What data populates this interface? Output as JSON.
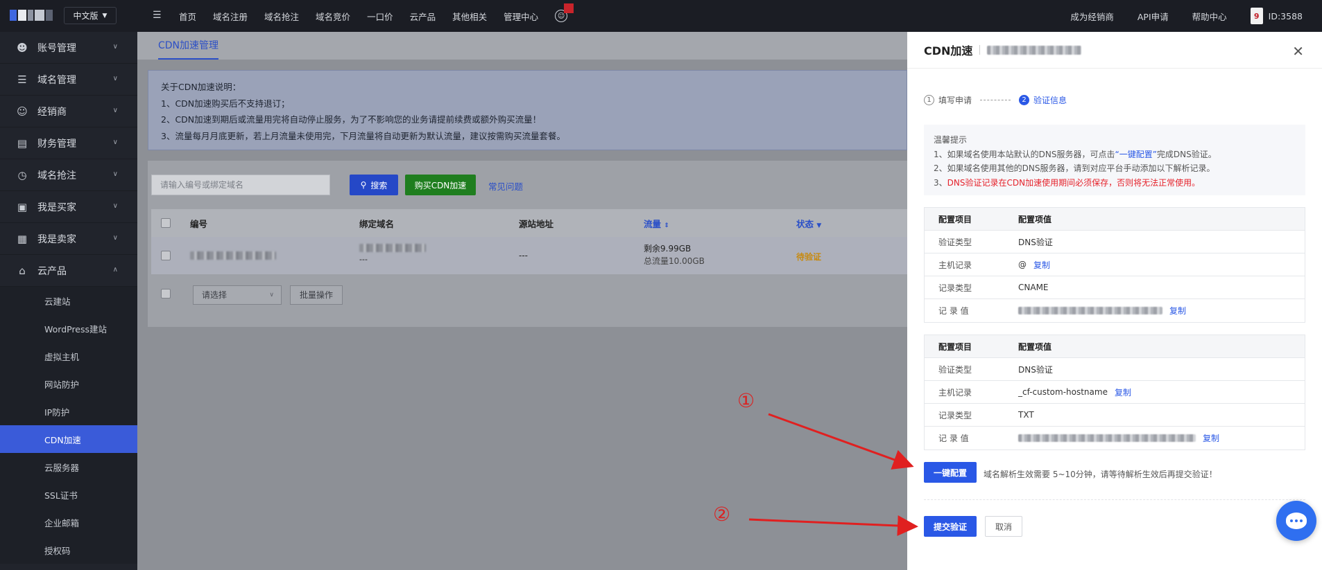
{
  "topbar": {
    "lang": "中文版",
    "nav": [
      "首页",
      "域名注册",
      "域名抢注",
      "域名竞价",
      "一口价",
      "云产品",
      "其他相关",
      "管理中心"
    ],
    "right": [
      "成为经销商",
      "API申请",
      "帮助中心"
    ],
    "avatar_text": "9",
    "user_id": "ID:3588"
  },
  "sidebar": {
    "items": [
      {
        "label": "账号管理",
        "icon": "user-icon"
      },
      {
        "label": "域名管理",
        "icon": "layers-icon"
      },
      {
        "label": "经销商",
        "icon": "agent-icon"
      },
      {
        "label": "财务管理",
        "icon": "finance-icon"
      },
      {
        "label": "域名抢注",
        "icon": "clock-icon"
      },
      {
        "label": "我是买家",
        "icon": "cart-icon"
      },
      {
        "label": "我是卖家",
        "icon": "shop-icon"
      },
      {
        "label": "云产品",
        "icon": "cloud-icon"
      }
    ],
    "sub": [
      "云建站",
      "WordPress建站",
      "虚拟主机",
      "网站防护",
      "IP防护",
      "CDN加速",
      "云服务器",
      "SSL证书",
      "企业邮箱",
      "授权码"
    ],
    "active_sub": "CDN加速"
  },
  "main": {
    "tab": "CDN加速管理",
    "notice": [
      "关于CDN加速说明：",
      "1、CDN加速购买后不支持退订；",
      "2、CDN加速到期后或流量用完将自动停止服务，为了不影响您的业务请提前续费或额外购买流量！",
      "3、流量每月月底更新，若上月流量未使用完，下月流量将自动更新为默认流量，建议按需购买流量套餐。"
    ],
    "search_placeholder": "请输入编号或绑定域名",
    "search_btn": "搜索",
    "buy_btn": "购买CDN加速",
    "faq": "常见问题",
    "columns": [
      "编号",
      "绑定域名",
      "源站地址",
      "流量",
      "状态"
    ],
    "row": {
      "domain_sub": "---",
      "origin": "---",
      "remain": "剩余9.99GB",
      "total": "总流量10.00GB",
      "status": "待验证"
    },
    "select_placeholder": "请选择",
    "batch_btn": "批量操作"
  },
  "drawer": {
    "title": "CDN加速",
    "steps": [
      {
        "num": "1",
        "label": "填写申请"
      },
      {
        "num": "2",
        "label": "验证信息"
      }
    ],
    "tips": {
      "title": "温馨提示",
      "line1_a": "1、如果域名使用本站默认的DNS服务器，可点击",
      "line1_link": "“一键配置”",
      "line1_b": "完成DNS验证。",
      "line2": "2、如果域名使用其他的DNS服务器，请到对应平台手动添加以下解析记录。",
      "line3_a": "3、",
      "line3_red": "DNS验证记录在CDN加速使用期间必须保存，否则将无法正常使用。"
    },
    "table1": {
      "header": [
        "配置项目",
        "配置项值"
      ],
      "rows": [
        {
          "label": "验证类型",
          "value": "DNS验证"
        },
        {
          "label": "主机记录",
          "value": "@"
        },
        {
          "label": "记录类型",
          "value": "CNAME"
        },
        {
          "label": "记 录 值",
          "value": ""
        }
      ]
    },
    "table2": {
      "header": [
        "配置项目",
        "配置项值"
      ],
      "rows": [
        {
          "label": "验证类型",
          "value": "DNS验证"
        },
        {
          "label": "主机记录",
          "value": "_cf-custom-hostname"
        },
        {
          "label": "记录类型",
          "value": "TXT"
        },
        {
          "label": "记 录 值",
          "value": ""
        }
      ]
    },
    "copy": "复制",
    "one_click_btn": "一键配置",
    "hint": "域名解析生效需要 5~10分钟，请等待解析生效后再提交验证！",
    "submit_btn": "提交验证",
    "cancel_btn": "取消"
  },
  "annotations": [
    "①",
    "②"
  ],
  "colors": {
    "accent": "#2a58e6",
    "annotation": "#e02020",
    "sidebar": "#21242c",
    "active": "#3a5bd9"
  }
}
